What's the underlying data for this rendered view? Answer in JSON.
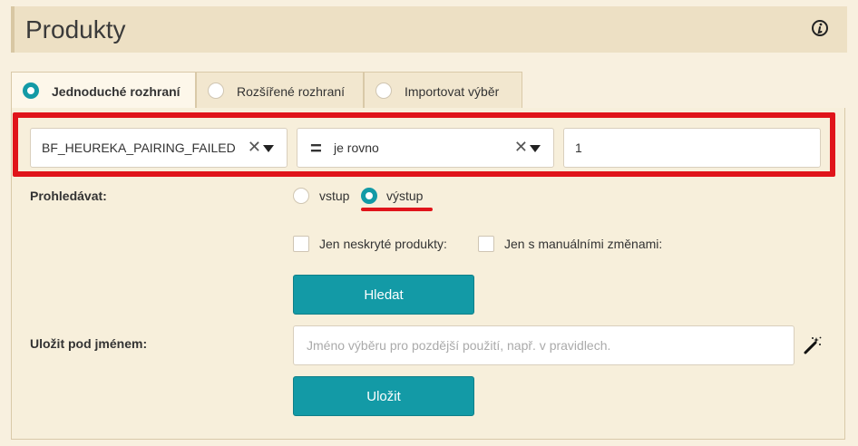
{
  "header": {
    "title": "Produkty",
    "info_icon": "info-icon"
  },
  "tabs": [
    {
      "label": "Jednoduché rozhraní",
      "active": true
    },
    {
      "label": "Rozšířené rozhraní",
      "active": false
    },
    {
      "label": "Importovat výběr",
      "active": false
    }
  ],
  "filter": {
    "field_value": "BF_HEUREKA_PAIRING_FAILED",
    "operator_symbol": "=",
    "operator_label": "je rovno",
    "value": "1",
    "clear_glyph": "✕"
  },
  "search_in": {
    "label": "Prohledávat:",
    "options": [
      {
        "label": "vstup",
        "selected": false
      },
      {
        "label": "výstup",
        "selected": true
      }
    ]
  },
  "checkboxes": [
    {
      "label": "Jen neskryté produkty:",
      "checked": false
    },
    {
      "label": "Jen s manuálními změnami:",
      "checked": false
    }
  ],
  "search_button": "Hledat",
  "save": {
    "label": "Uložit pod jménem:",
    "placeholder": "Jméno výběru pro pozdější použití, např. v pravidlech.",
    "button": "Uložit",
    "wand_icon": "magic-wand-icon"
  },
  "colors": {
    "accent": "#139aa6",
    "highlight": "#e0141a",
    "background": "#f8f0df"
  }
}
